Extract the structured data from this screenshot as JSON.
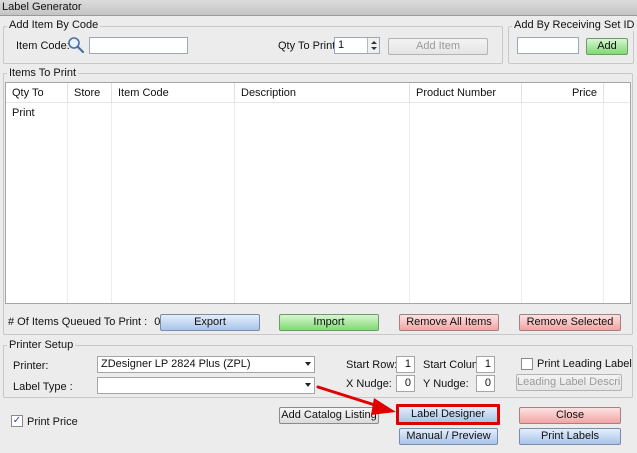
{
  "window": {
    "title": "Label Generator"
  },
  "add_item": {
    "group_title": "Add Item By Code",
    "item_code_label": "Item Code:",
    "item_code_value": "",
    "qty_label": "Qty To Print:",
    "qty_value": "1",
    "add_item_button": "Add Item"
  },
  "receiving": {
    "group_title": "Add By Receiving Set ID",
    "value": "",
    "add_button": "Add"
  },
  "items": {
    "group_title": "Items To Print",
    "columns": [
      "Qty To Print",
      "Store",
      "Item Code",
      "Description",
      "Product Number",
      "Price"
    ],
    "rows": []
  },
  "queue": {
    "label": "# Of Items Queued To Print :",
    "count": "0",
    "export_button": "Export",
    "import_button": "Import",
    "remove_all_button": "Remove All Items",
    "remove_selected_button": "Remove Selected"
  },
  "printer_setup": {
    "group_title": "Printer Setup",
    "printer_label": "Printer:",
    "printer_value": "ZDesigner LP 2824 Plus (ZPL)",
    "label_type_label": "Label Type :",
    "label_type_value": "",
    "start_row_label": "Start Row:",
    "start_row_value": "1",
    "start_col_label": "Start Column:",
    "start_col_value": "1",
    "x_nudge_label": "X Nudge:",
    "x_nudge_value": "0",
    "y_nudge_label": "Y Nudge:",
    "y_nudge_value": "0",
    "print_leading_label": "Print Leading Label",
    "leading_desc_button": "Leading Label Description"
  },
  "bottom": {
    "print_price_label": "Print Price",
    "print_price_checked": true,
    "add_catalog_button": "Add Catalog Listing",
    "label_designer_button": "Label Designer",
    "manual_preview_button": "Manual / Preview",
    "close_button": "Close",
    "print_labels_button": "Print Labels"
  },
  "colors": {
    "highlight": "#e00000",
    "arrow": "#e00000"
  }
}
